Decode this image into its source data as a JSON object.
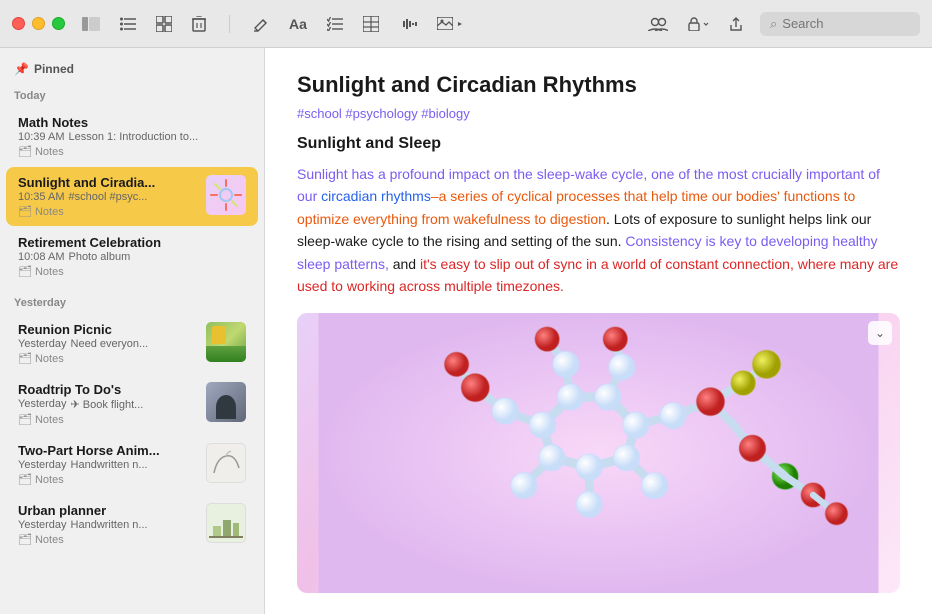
{
  "titlebar": {
    "actions_left": [
      "sidebar-toggle",
      "list-view",
      "grid-view",
      "delete"
    ],
    "actions_right": [
      "compose",
      "font",
      "list-indent",
      "table",
      "audio",
      "media-dropdown",
      "collaborate",
      "lock-dropdown",
      "share"
    ],
    "search_placeholder": "Search"
  },
  "sidebar": {
    "pinned_label": "Pinned",
    "sections": [
      {
        "label": "Today",
        "notes": [
          {
            "title": "Math Notes",
            "time": "10:39 AM",
            "preview": "Lesson 1: Introduction to...",
            "folder": "Notes",
            "thumb": null,
            "active": false
          },
          {
            "title": "Sunlight and Ciradia...",
            "time": "10:35 AM",
            "preview": "#school #psyc...",
            "folder": "Notes",
            "thumb": "molecule",
            "active": true
          },
          {
            "title": "Retirement Celebration",
            "time": "10:08 AM",
            "preview": "Photo album",
            "folder": "Notes",
            "thumb": null,
            "active": false
          }
        ]
      },
      {
        "label": "Yesterday",
        "notes": [
          {
            "title": "Reunion Picnic",
            "time": "Yesterday",
            "preview": "Need everyon...",
            "folder": "Notes",
            "thumb": "picnic",
            "active": false
          },
          {
            "title": "Roadtrip To Do's",
            "time": "Yesterday",
            "preview": "✈ Book flight...",
            "folder": "Notes",
            "thumb": "roadtrip",
            "active": false
          },
          {
            "title": "Two-Part Horse Anim...",
            "time": "Yesterday",
            "preview": "Handwritten n...",
            "folder": "Notes",
            "thumb": "horse",
            "active": false
          },
          {
            "title": "Urban planner",
            "time": "Yesterday",
            "preview": "Handwritten n...",
            "folder": "Notes",
            "thumb": "urban",
            "active": false
          }
        ]
      }
    ]
  },
  "note": {
    "title": "Sunlight and Circadian Rhythms",
    "tags": "#school #psychology #biology",
    "subtitle": "Sunlight and Sleep",
    "body_segments": [
      {
        "text": "Sunlight has a profound impact on the sleep-wake cycle, one of the most crucially important of our ",
        "style": "purple"
      },
      {
        "text": "circadian rhythms",
        "style": "blue"
      },
      {
        "text": "–a series of cyclical processes that help time our bodies' functions to optimize everything from wakefulness to digestion",
        "style": "orange"
      },
      {
        "text": ". Lots of exposure to sunlight helps link our sleep-wake cycle to the rising and setting of the sun. ",
        "style": "normal"
      },
      {
        "text": "Consistency is key to developing healthy sleep patterns,",
        "style": "purple"
      },
      {
        "text": " and ",
        "style": "normal"
      },
      {
        "text": "it's easy to slip out of sync in a world of constant connection, where many are used to working across multiple timezones.",
        "style": "red"
      }
    ]
  }
}
